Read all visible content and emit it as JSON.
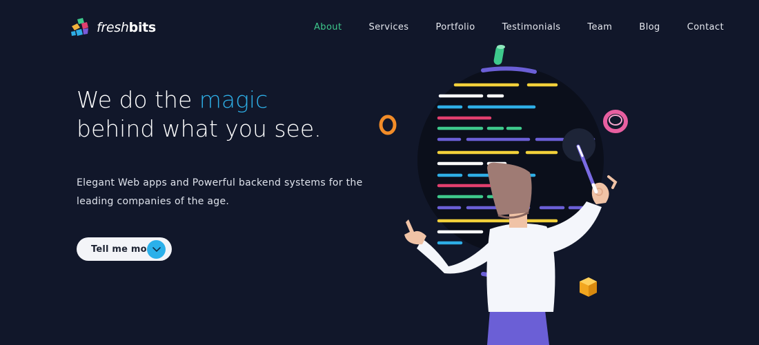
{
  "brand": {
    "name_light": "fresh",
    "name_bold": "bits"
  },
  "nav": {
    "items": [
      {
        "label": "About",
        "active": true
      },
      {
        "label": "Services"
      },
      {
        "label": "Portfolio"
      },
      {
        "label": "Testimonials"
      },
      {
        "label": "Team"
      },
      {
        "label": "Blog"
      },
      {
        "label": "Contact"
      }
    ]
  },
  "hero": {
    "title_line1_pre": "We do the ",
    "title_accent": "magic",
    "title_line2": "behind what you see.",
    "subtitle": "Elegant Web apps and Powerful backend systems for the leading companies of the age.",
    "cta_label": "Tell me more",
    "cta_icon": "chevron-down-icon"
  },
  "colors": {
    "background": "#11172a",
    "nav_active": "#3ec98c",
    "accent": "#2eaee6",
    "cta_background": "#f3f4f8",
    "cta_icon": "#2bb0ea"
  },
  "illustration": {
    "subject": "developer conducting code lines",
    "icons": [
      "wand-icon",
      "ring-icon",
      "torus-icon",
      "cube-icon",
      "cylinder-icon"
    ]
  }
}
